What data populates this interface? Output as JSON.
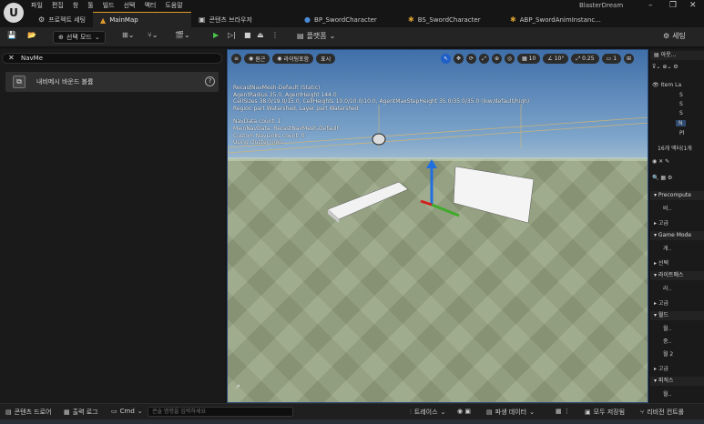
{
  "app": {
    "title": "BlasterDream",
    "logo": "U"
  },
  "menu": [
    "파일",
    "편집",
    "창",
    "툴",
    "빌드",
    "선택",
    "액터",
    "도움말"
  ],
  "tabs": [
    {
      "label": "프로젝트 세팅",
      "icon": "gear-icon",
      "active": false
    },
    {
      "label": "MainMap",
      "icon": "level-icon",
      "active": true
    },
    {
      "label": "콘텐츠 브라우저",
      "icon": "folder-icon",
      "active": false
    },
    {
      "label": "BP_SwordCharacter",
      "icon": "character-icon",
      "active": false
    },
    {
      "label": "BS_SwordCharacter",
      "icon": "blendspace-icon",
      "active": false
    },
    {
      "label": "ABP_SwordAnimInstanc...",
      "icon": "anim-icon",
      "active": false
    }
  ],
  "toolbar": {
    "select_mode": "선택 모드",
    "platforms": "플랫폼",
    "settings": "세팅"
  },
  "left_panel": {
    "search_value": "NavMe",
    "result_item": {
      "label": "내비메시 바운드 볼륨",
      "icon": "navmesh-volume-icon"
    }
  },
  "viewport": {
    "perspective": "원근",
    "lit": "라이팅포함",
    "show": "표시",
    "grid_snap": "10",
    "rot_snap": "10°",
    "scale_snap": "0.25",
    "camera_speed": "1",
    "stats": [
      "RecastNavMesh-Default (Static)",
      "AgentRadius 35.0, AgentHeight 144.0",
      "CellSizes 38.0/19.0/15.0, CellHeights 10.0/10.0/10.0, AgentMaxStepHeight 35.0/35.0/35.0 (low/default/high)",
      "Region part Watershed, Layer part Watershed"
    ],
    "stats2": [
      "NavData count: 1",
      "MainNavData: RecastNavMesh-Default",
      "Custom NavLinks count: 0",
      "Using cluster links"
    ]
  },
  "right_panel": {
    "outliner_tab": "아웃...",
    "item_label": "Item La",
    "actor_count": "16개 액터(1개",
    "sections": [
      "Precompute",
      "고급",
      "Game Mode",
      "선택",
      "라이트매스",
      "고급",
      "월드",
      "고급",
      "피직스"
    ],
    "rows": [
      "S",
      "S",
      "S",
      "N",
      "Pl",
      "비..",
      "게..",
      "라..",
      "월..",
      "중..",
      "월 2",
      "월.."
    ]
  },
  "bottom": {
    "content_drawer": "콘텐츠 드로어",
    "output_log": "출력 로그",
    "cmd": "Cmd",
    "cmd_placeholder": "콘솔 명령을 입력하세요",
    "trace": "트레이스",
    "derived": "파생 데이터",
    "save_all": "모두 저장됨",
    "revision": "리비전 컨트롤"
  }
}
